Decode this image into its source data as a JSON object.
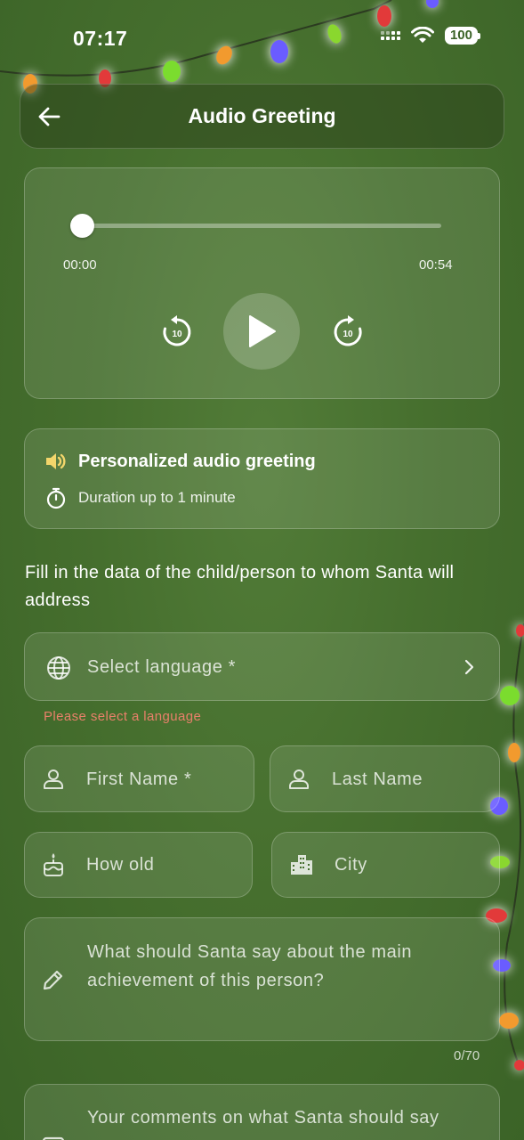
{
  "status_bar": {
    "time": "07:17",
    "battery": "100"
  },
  "header": {
    "title": "Audio Greeting",
    "back_icon": "arrow-left-icon"
  },
  "player": {
    "current_time": "00:00",
    "total_time": "00:54",
    "progress": 0,
    "rewind_label": "10",
    "forward_label": "10"
  },
  "info": {
    "title": "Personalized audio greeting",
    "subtitle": "Duration up to 1 minute"
  },
  "instructions": "Fill in the data of the child/person to whom Santa will address",
  "form": {
    "language_placeholder": "Select language *",
    "language_error": "Please select a language",
    "first_name_placeholder": "First Name *",
    "last_name_placeholder": "Last Name",
    "age_placeholder": "How old",
    "city_placeholder": "City",
    "achievement_placeholder": "What should Santa say about the main achievement of this person?",
    "achievement_counter": "0/70",
    "comments_placeholder": "Your comments on what Santa should say"
  },
  "colors": {
    "background": "#466f2e",
    "error": "#e8806a",
    "accent_icon": "#f2d56b"
  }
}
